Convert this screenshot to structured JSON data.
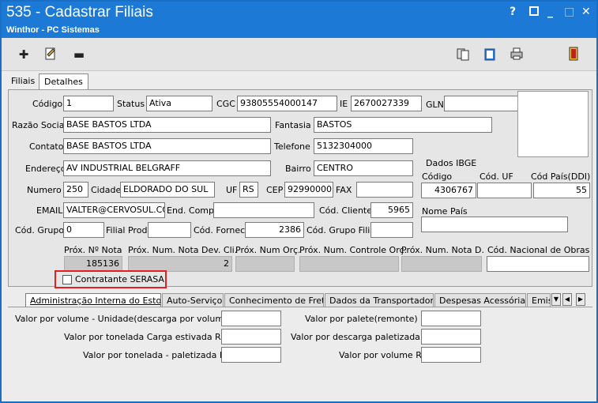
{
  "window": {
    "title": "535 - Cadastrar Filiais",
    "subtitle": "Winthor - PC Sistemas",
    "controls": {
      "help": "?",
      "min": "_",
      "max": "□",
      "close": "✕"
    }
  },
  "toolbar": {
    "icons": [
      "plus-icon",
      "edit-doc-icon",
      "minus-icon",
      "copy-icon",
      "clipboard-icon",
      "printer-icon",
      "exit-door-icon"
    ]
  },
  "tabs_top": [
    "Filiais",
    "Detalhes"
  ],
  "form": {
    "codigo": {
      "label": "Código",
      "value": "1"
    },
    "status": {
      "label": "Status",
      "value": "Ativa"
    },
    "cgc": {
      "label": "CGC",
      "value": "93805554000147"
    },
    "ie": {
      "label": "IE",
      "value": "2670027339"
    },
    "gln": {
      "label": "GLN",
      "value": ""
    },
    "razao_social": {
      "label": "Razão Social",
      "value": "BASE BASTOS LTDA"
    },
    "fantasia": {
      "label": "Fantasia",
      "value": "BASTOS"
    },
    "contato": {
      "label": "Contato",
      "value": "BASE BASTOS LTDA"
    },
    "telefone": {
      "label": "Telefone",
      "value": "5132304000"
    },
    "endereco": {
      "label": "Endereço",
      "value": "AV INDUSTRIAL BELGRAFF"
    },
    "bairro": {
      "label": "Bairro",
      "value": "CENTRO"
    },
    "numero": {
      "label": "Numero",
      "value": "250"
    },
    "cidade": {
      "label": "Cidade",
      "value": "ELDORADO DO SUL"
    },
    "uf": {
      "label": "UF",
      "value": "RS"
    },
    "cep": {
      "label": "CEP",
      "value": "92990000"
    },
    "fax": {
      "label": "FAX",
      "value": ""
    },
    "email": {
      "label": "EMAIL",
      "value": "VALTER@CERVOSUL.COM"
    },
    "end_comp": {
      "label": "End. Comp.",
      "value": ""
    },
    "cod_cliente": {
      "label": "Cód. Cliente",
      "value": "5965"
    },
    "cod_grupo": {
      "label": "Cód. Grupo",
      "value": "0"
    },
    "filial_prod": {
      "label": "Filial Prod.",
      "value": ""
    },
    "cod_fornec": {
      "label": "Cód. Fornec.",
      "value": "2386"
    },
    "cod_grupo_filial": {
      "label": "Cód. Grupo Filial",
      "value": ""
    }
  },
  "ibge": {
    "title": "Dados IBGE",
    "codigo": {
      "label": "Código",
      "value": "4306767"
    },
    "cod_uf": {
      "label": "Cód. UF",
      "value": ""
    },
    "cod_pais": {
      "label": "Cód País(DDI)",
      "value": "55"
    },
    "nome_pais": {
      "label": "Nome País",
      "value": ""
    }
  },
  "prox": {
    "nota": {
      "label": "Próx. Nº Nota",
      "value": "185136"
    },
    "nota_dev": {
      "label": "Próx. Num. Nota Dev. Cli.",
      "value": "2"
    },
    "orc": {
      "label": "Próx. Num Orç.",
      "value": ""
    },
    "controle_orc": {
      "label": "Próx. Num. Controle Orç.",
      "value": ""
    },
    "nota_d": {
      "label": "Próx. Num. Nota D.",
      "value": ""
    },
    "cod_obras": {
      "label": "Cód. Nacional de Obras",
      "value": ""
    }
  },
  "serasa": {
    "label": "Contratante SERASA",
    "checked": false
  },
  "tabs_bottom": [
    "Administração Interna do Estoque",
    "Auto-Serviço",
    "Conhecimento de Frete",
    "Dados da Transportadora",
    "Despesas Acessórias",
    "Emiss"
  ],
  "bottom_fields": {
    "vol_unidade": {
      "label": "Valor por volume - Unidade(descarga por volume)R$:",
      "value": ""
    },
    "ton_carga": {
      "label": "Valor por tonelada Carga estivada R$:",
      "value": ""
    },
    "ton_palet": {
      "label": "Valor por tonelada - paletizada R$:",
      "value": ""
    },
    "palete": {
      "label": "Valor por palete(remonte) R$:",
      "value": ""
    },
    "descarga_palet": {
      "label": "Valor por descarga paletizada R$:",
      "value": ""
    },
    "volume": {
      "label": "Valor por volume R$:",
      "value": ""
    }
  }
}
